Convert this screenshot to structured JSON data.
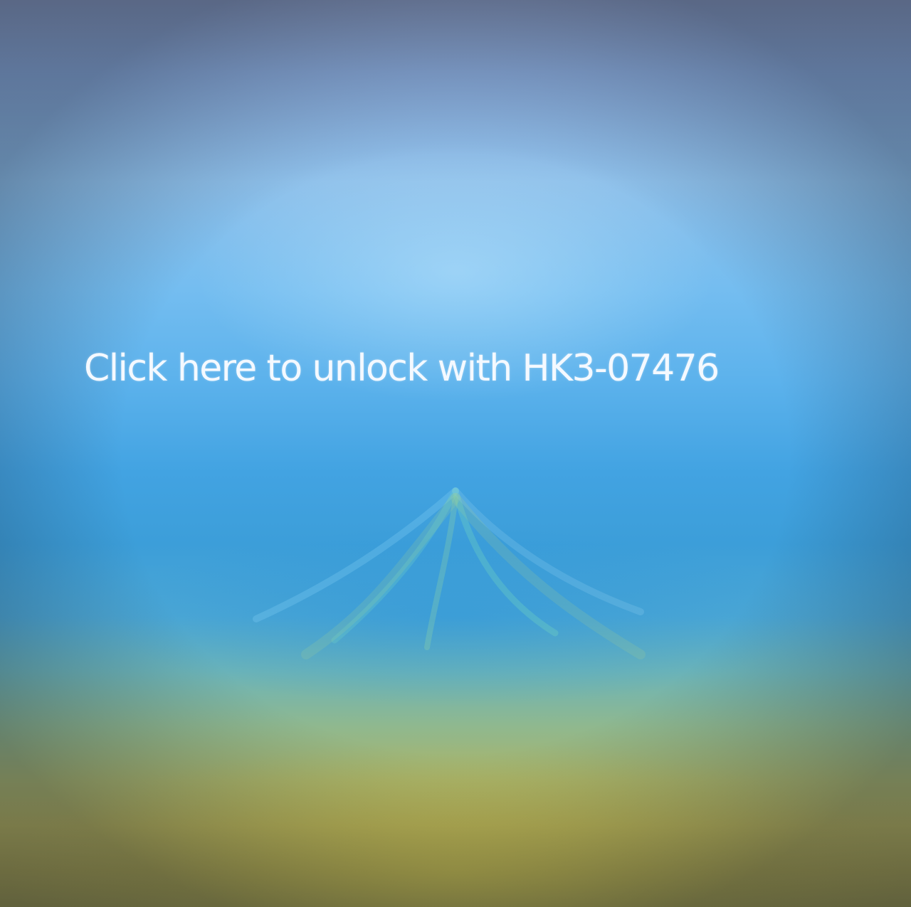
{
  "lock_screen": {
    "unlock_prompt": "Click here to unlock with HK3-07476"
  },
  "colors": {
    "text": "#f4f9ff",
    "sky_top": "#7f8fb2",
    "sky_mid": "#42a3e2",
    "ground": "#b0ab55"
  }
}
